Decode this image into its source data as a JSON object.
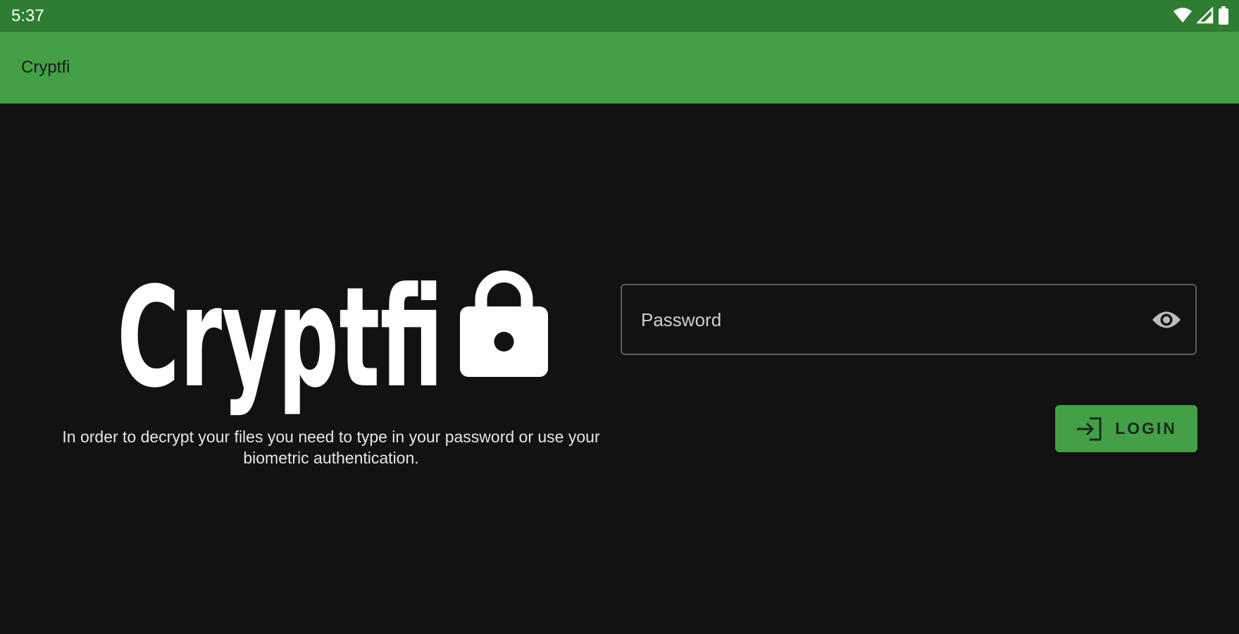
{
  "status_bar": {
    "time": "5:37",
    "icons": [
      "wifi-icon",
      "signal-icon",
      "battery-icon"
    ]
  },
  "app_bar": {
    "title": "Cryptfi"
  },
  "logo": {
    "text": "Cryptfi",
    "icon": "lock-icon"
  },
  "description": "In order to decrypt your files you need to type in your password or use your biometric authentication.",
  "password_field": {
    "label": "Password",
    "value": "",
    "toggle_icon": "eye-icon"
  },
  "login_button": {
    "label": "LOGIN",
    "icon": "login-icon"
  },
  "colors": {
    "status_bar": "#2e7d32",
    "app_bar": "#43a047",
    "background": "#121212",
    "accent": "#43a047"
  }
}
